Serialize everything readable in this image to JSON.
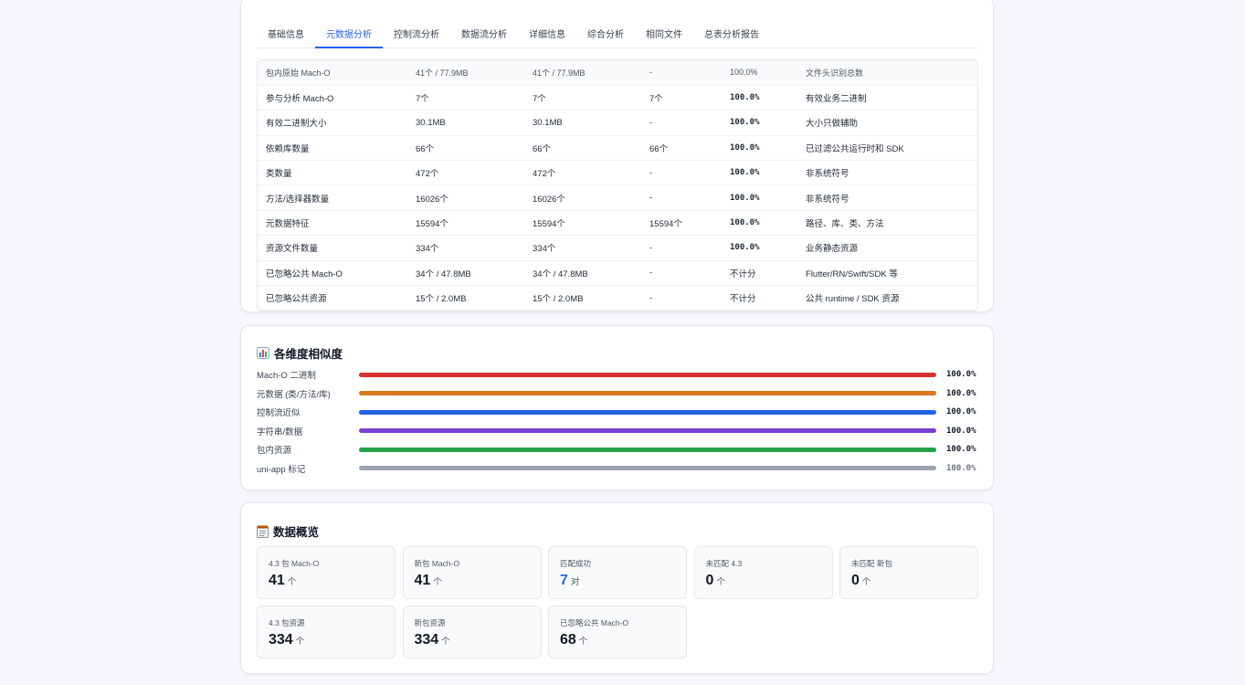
{
  "tabs": [
    {
      "label": "基础信息",
      "active": false
    },
    {
      "label": "元数据分析",
      "active": true
    },
    {
      "label": "控制流分析",
      "active": false
    },
    {
      "label": "数据流分析",
      "active": false
    },
    {
      "label": "详细信息",
      "active": false
    },
    {
      "label": "综合分析",
      "active": false
    },
    {
      "label": "相同文件",
      "active": false
    },
    {
      "label": "总表分析报告",
      "active": false
    }
  ],
  "table": {
    "rows": [
      {
        "metric": "包内原始 Mach-O",
        "a": "41个 / 77.9MB",
        "b": "41个 / 77.9MB",
        "matched": "-",
        "score": "100.0%",
        "note": "文件头识别总数"
      },
      {
        "metric": "参与分析 Mach-O",
        "a": "7个",
        "b": "7个",
        "matched": "7个",
        "score": "100.0%",
        "note": "有效业务二进制"
      },
      {
        "metric": "有效二进制大小",
        "a": "30.1MB",
        "b": "30.1MB",
        "matched": "-",
        "score": "100.0%",
        "note": "大小只做辅助"
      },
      {
        "metric": "依赖库数量",
        "a": "66个",
        "b": "66个",
        "matched": "66个",
        "score": "100.0%",
        "note": "已过滤公共运行时和 SDK"
      },
      {
        "metric": "类数量",
        "a": "472个",
        "b": "472个",
        "matched": "-",
        "score": "100.0%",
        "note": "非系统符号"
      },
      {
        "metric": "方法/选择器数量",
        "a": "16026个",
        "b": "16026个",
        "matched": "-",
        "score": "100.0%",
        "note": "非系统符号"
      },
      {
        "metric": "元数据特征",
        "a": "15594个",
        "b": "15594个",
        "matched": "15594个",
        "score": "100.0%",
        "note": "路径、库、类、方法"
      },
      {
        "metric": "资源文件数量",
        "a": "334个",
        "b": "334个",
        "matched": "-",
        "score": "100.0%",
        "note": "业务静态资源"
      },
      {
        "metric": "已忽略公共 Mach-O",
        "a": "34个 / 47.8MB",
        "b": "34个 / 47.8MB",
        "matched": "-",
        "score": "不计分",
        "note": "Flutter/RN/Swift/SDK 等"
      },
      {
        "metric": "已忽略公共资源",
        "a": "15个 / 2.0MB",
        "b": "15个 / 2.0MB",
        "matched": "-",
        "score": "不计分",
        "note": "公共 runtime / SDK 资源"
      }
    ]
  },
  "similarity": {
    "title": "各维度相似度",
    "icon": "bar-chart-icon",
    "items": [
      {
        "label": "Mach-O 二进制",
        "value": "100.0%",
        "fraction": 1.0,
        "color": "#d63232"
      },
      {
        "label": "元数据 (类/方法/库)",
        "value": "100.0%",
        "fraction": 1.0,
        "color": "#d9791b"
      },
      {
        "label": "控制流近似",
        "value": "100.0%",
        "fraction": 1.0,
        "color": "#2563eb"
      },
      {
        "label": "字符串/数据",
        "value": "100.0%",
        "fraction": 1.0,
        "color": "#7c3fd6"
      },
      {
        "label": "包内资源",
        "value": "100.0%",
        "fraction": 1.0,
        "color": "#27a047"
      },
      {
        "label": "uni-app 标记",
        "value": "100.0%",
        "fraction": 1.0,
        "color": "#9ca3af"
      }
    ]
  },
  "overview": {
    "title": "数据概览",
    "icon": "memo-icon",
    "stats": [
      {
        "label": "4.3 包 Mach-O",
        "value": "41",
        "unit": "个",
        "highlight": false
      },
      {
        "label": "新包 Mach-O",
        "value": "41",
        "unit": "个",
        "highlight": false
      },
      {
        "label": "匹配成功",
        "value": "7",
        "unit": "对",
        "highlight": true
      },
      {
        "label": "未匹配 4.3",
        "value": "0",
        "unit": "个",
        "highlight": false
      },
      {
        "label": "未匹配 新包",
        "value": "0",
        "unit": "个",
        "highlight": false
      },
      {
        "label": "4.3 包资源",
        "value": "334",
        "unit": "个",
        "highlight": false
      },
      {
        "label": "新包资源",
        "value": "334",
        "unit": "个",
        "highlight": false
      },
      {
        "label": "已忽略公共 Mach-O",
        "value": "68",
        "unit": "个",
        "highlight": false
      }
    ]
  }
}
